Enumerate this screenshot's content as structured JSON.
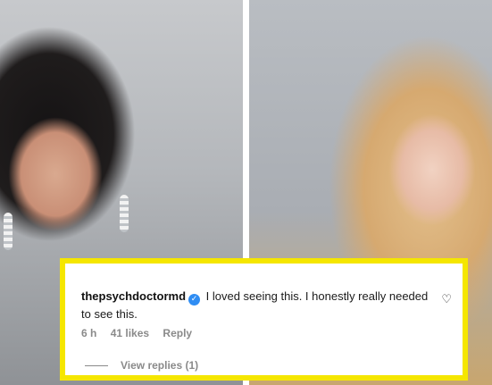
{
  "comment": {
    "username": "thepsychdoctormd",
    "verified_icon": "verified-badge-icon",
    "text": "I loved seeing this. I honestly really needed to see this.",
    "time": "6 h",
    "likes": "41 likes",
    "reply_label": "Reply",
    "view_replies_label": "View replies (1)",
    "like_icon": "heart-icon"
  },
  "colors": {
    "highlight_border": "#f5e600",
    "verified_badge": "#2f8df3",
    "meta_text": "#8a8a8a"
  }
}
